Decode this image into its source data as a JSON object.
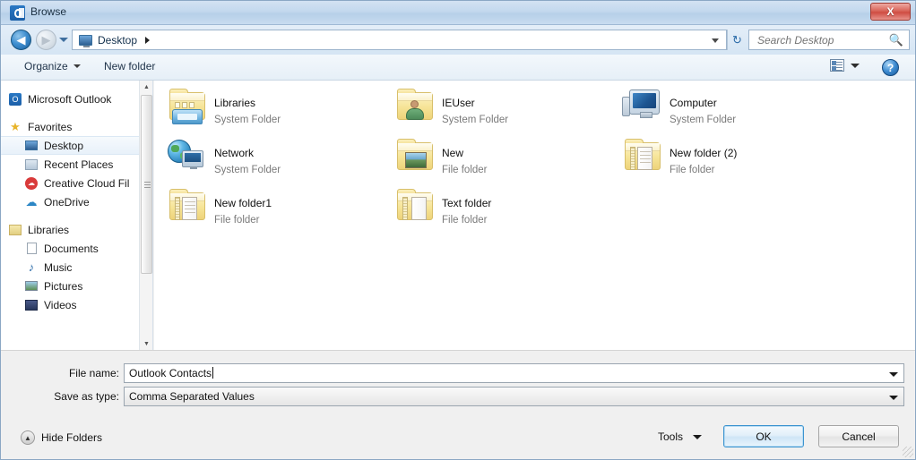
{
  "window": {
    "title": "Browse",
    "app_icon": "outlook-icon",
    "close_label": "X",
    "accent_color": "#3c94d0",
    "titlebar_color": "#c3d8ee",
    "close_color": "#cf4c42"
  },
  "nav": {
    "back_glyph": "◀",
    "forward_glyph": "▶",
    "breadcrumb": {
      "icon": "desktop-icon",
      "label": "Desktop"
    },
    "refresh_glyph": "↻"
  },
  "search": {
    "placeholder": "Search Desktop",
    "value": "",
    "icon": "search-icon"
  },
  "toolbar": {
    "organize_label": "Organize",
    "new_folder_label": "New folder",
    "view_icon": "view-mode-icon",
    "help_label": "?"
  },
  "sidebar": {
    "groups": [
      {
        "header": {
          "label": "Microsoft Outlook",
          "icon": "outlook-icon",
          "indent": false
        },
        "items": []
      },
      {
        "header": {
          "label": "Favorites",
          "icon": "star-icon",
          "indent": false
        },
        "items": [
          {
            "label": "Desktop",
            "icon": "desktop-icon",
            "selected": true
          },
          {
            "label": "Recent Places",
            "icon": "recent-places-icon",
            "selected": false
          },
          {
            "label": "Creative Cloud Fil",
            "icon": "creative-cloud-icon",
            "selected": false
          },
          {
            "label": "OneDrive",
            "icon": "onedrive-icon",
            "selected": false
          }
        ]
      },
      {
        "header": {
          "label": "Libraries",
          "icon": "libraries-icon",
          "indent": false
        },
        "items": [
          {
            "label": "Documents",
            "icon": "document-icon",
            "selected": false
          },
          {
            "label": "Music",
            "icon": "music-icon",
            "selected": false
          },
          {
            "label": "Pictures",
            "icon": "pictures-icon",
            "selected": false
          },
          {
            "label": "Videos",
            "icon": "videos-icon",
            "selected": false
          }
        ]
      }
    ]
  },
  "filelist": {
    "items": [
      {
        "name": "Libraries",
        "type": "System Folder",
        "icon": "libraries-folder-icon",
        "col": 0,
        "row": 0
      },
      {
        "name": "Network",
        "type": "System Folder",
        "icon": "network-icon",
        "col": 0,
        "row": 1
      },
      {
        "name": "New folder1",
        "type": "File folder",
        "icon": "folder-paper-icon",
        "col": 0,
        "row": 2
      },
      {
        "name": "IEUser",
        "type": "System Folder",
        "icon": "folder-user-icon",
        "col": 1,
        "row": 0
      },
      {
        "name": "New",
        "type": "File folder",
        "icon": "folder-picture-icon",
        "col": 1,
        "row": 1
      },
      {
        "name": "Text folder",
        "type": "File folder",
        "icon": "folder-text-icon",
        "col": 1,
        "row": 2
      },
      {
        "name": "Computer",
        "type": "System Folder",
        "icon": "computer-icon",
        "col": 2,
        "row": 0
      },
      {
        "name": "New folder (2)",
        "type": "File folder",
        "icon": "folder-paper-icon",
        "col": 2,
        "row": 1
      }
    ]
  },
  "form": {
    "filename_label": "File name:",
    "filename_value": "Outlook Contacts",
    "savetype_label": "Save as type:",
    "savetype_value": "Comma Separated Values"
  },
  "footer": {
    "hide_folders_label": "Hide Folders",
    "tools_label": "Tools",
    "ok_label": "OK",
    "cancel_label": "Cancel"
  }
}
